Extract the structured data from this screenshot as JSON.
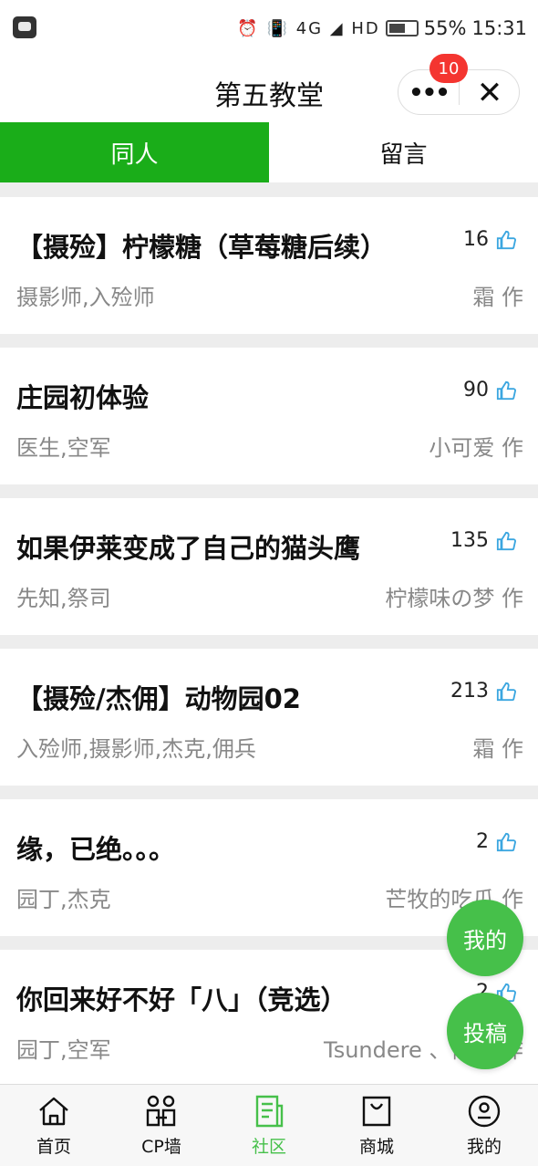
{
  "status_bar": {
    "battery": "55%",
    "time": "15:31",
    "icons": "⏰ 📳 4G ◢ HD"
  },
  "header": {
    "title": "第五教堂",
    "more_glyph": "•••",
    "close_glyph": "✕",
    "badge_count": "10"
  },
  "tabs": [
    {
      "label": "同人",
      "active": true
    },
    {
      "label": "留言",
      "active": false
    }
  ],
  "posts": [
    {
      "title": "【摄殓】柠檬糖（草莓糖后续）",
      "likes": "16",
      "tags": "摄影师,入殓师",
      "author": "霜 作"
    },
    {
      "title": "庄园初体验",
      "likes": "90",
      "tags": "医生,空军",
      "author": "小可爱 作"
    },
    {
      "title": "如果伊莱变成了自己的猫头鹰",
      "likes": "135",
      "tags": "先知,祭司",
      "author": "柠檬味の梦 作"
    },
    {
      "title": "【摄殓/杰佣】动物园02",
      "likes": "213",
      "tags": "入殓师,摄影师,杰克,佣兵",
      "author": "霜 作"
    },
    {
      "title": "缘，已绝。。。",
      "likes": "2",
      "tags": "园丁,杰克",
      "author": "芒牧的吃瓜 作"
    },
    {
      "title": "你回来好不好「八」（竞选）",
      "likes": "2",
      "tags": "园丁,空军",
      "author": "Tsundere 、倾城 作"
    }
  ],
  "fabs": {
    "mine": "我的",
    "post": "投稿"
  },
  "tabbar": [
    {
      "label": "首页",
      "icon": "home-icon"
    },
    {
      "label": "CP墙",
      "icon": "cp-wall-icon"
    },
    {
      "label": "社区",
      "icon": "community-icon",
      "active": true
    },
    {
      "label": "商城",
      "icon": "shop-bag-icon"
    },
    {
      "label": "我的",
      "icon": "profile-icon"
    }
  ],
  "colors": {
    "accent": "#1aad19",
    "fab": "#46c04a",
    "badge": "#f43530",
    "like_icon": "#3ba6e0"
  }
}
